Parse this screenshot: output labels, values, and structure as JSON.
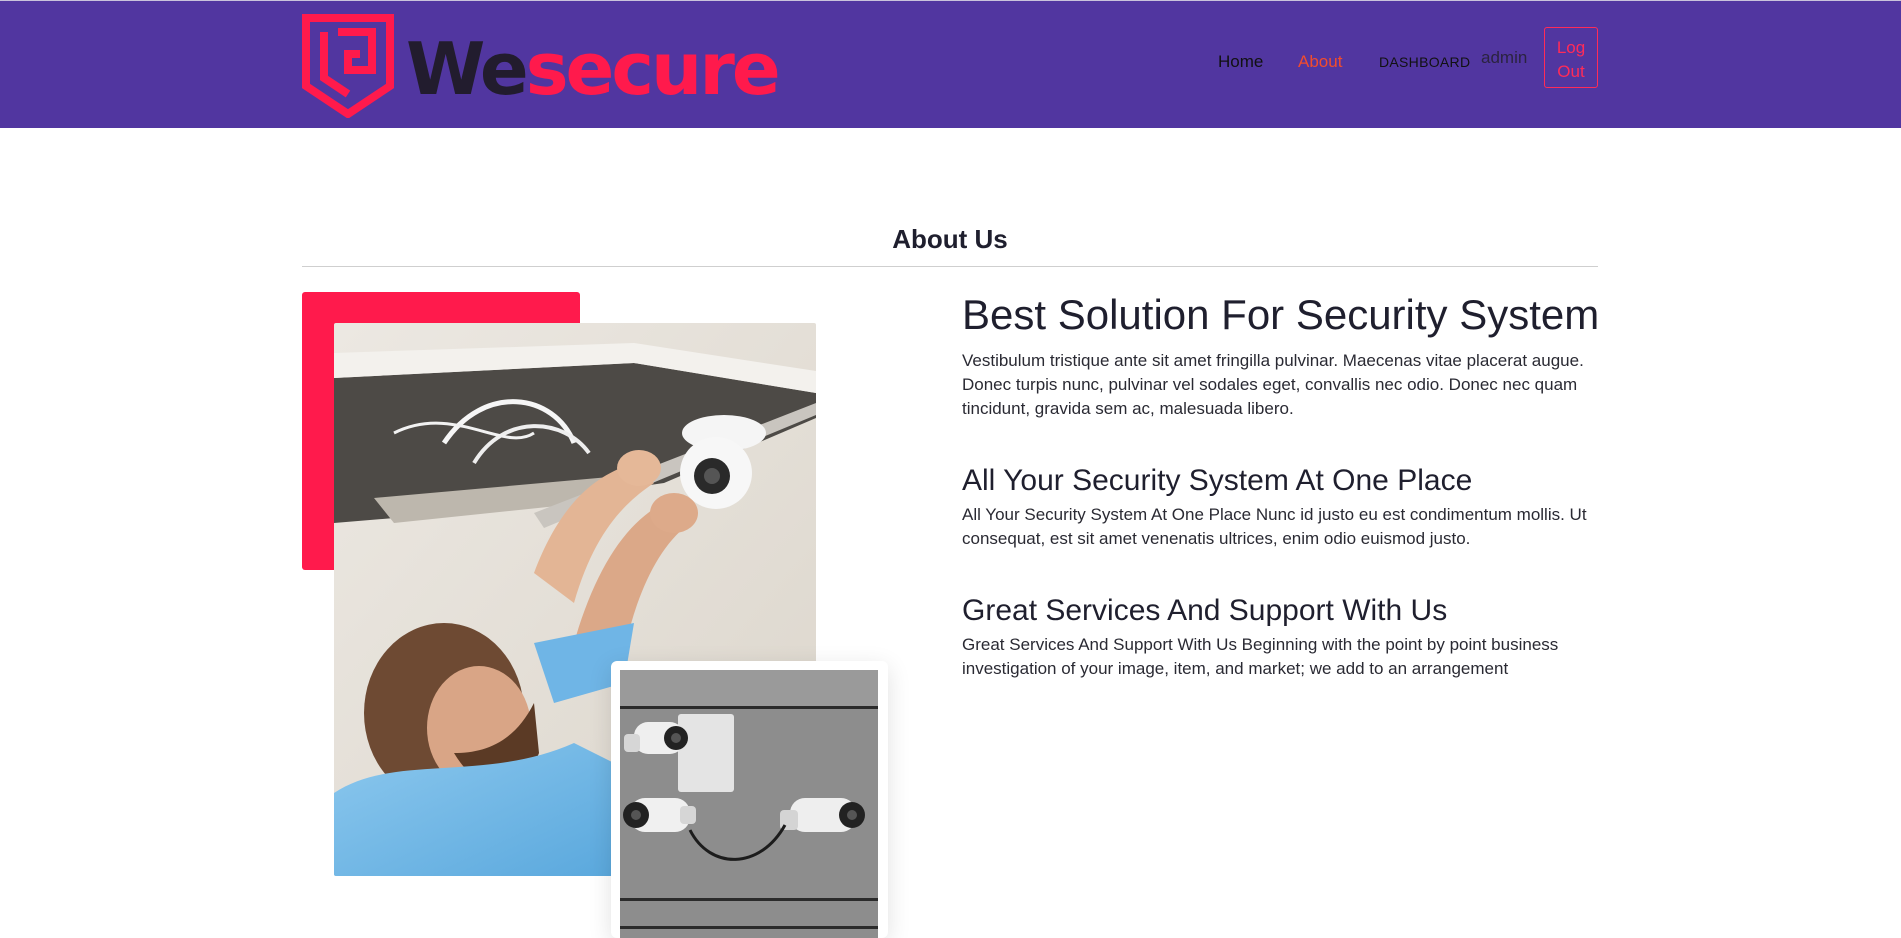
{
  "brand": {
    "name_part1": "We",
    "name_part2": "secure",
    "colors": {
      "header_bg": "#5136a0",
      "accent": "#ff1a4c",
      "dark": "#221c2e",
      "active_nav": "#f24c2c"
    }
  },
  "nav": {
    "home": "Home",
    "about": "About",
    "dashboard": "DASHBOARD",
    "user": "admin",
    "logout": "Log Out",
    "active": "About"
  },
  "about": {
    "title": "About Us",
    "main_heading": "Best Solution For Security System",
    "main_text": "Vestibulum tristique ante sit amet fringilla pulvinar. Maecenas vitae placerat augue. Donec turpis nunc, pulvinar vel sodales eget, convallis nec odio. Donec nec quam tincidunt, gravida sem ac, malesuada libero.",
    "sections": [
      {
        "heading": "All Your Security System At One Place",
        "text": "All Your Security System At One Place Nunc id justo eu est condimentum mollis. Ut consequat, est sit amet venenatis ultrices, enim odio euismod justo."
      },
      {
        "heading": "Great Services And Support With Us",
        "text": "Great Services And Support With Us Beginning with the point by point business investigation of your image, item, and market; we add to an arrangement"
      }
    ]
  },
  "images": {
    "main": "technician-installing-cctv-camera-photo",
    "inset": "security-cameras-on-wall-photo"
  }
}
